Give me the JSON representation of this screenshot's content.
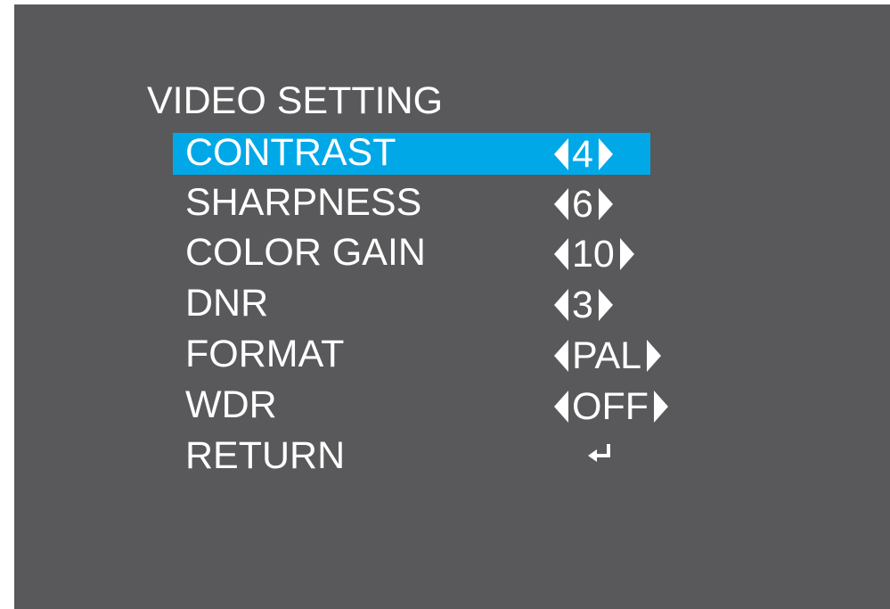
{
  "menu": {
    "title": "VIDEO SETTING",
    "selected_index": 0,
    "colors": {
      "background": "#59595b",
      "highlight": "#00a8e8",
      "text": "#ffffff"
    },
    "items": [
      {
        "label": "CONTRAST",
        "value": "4"
      },
      {
        "label": "SHARPNESS",
        "value": "6"
      },
      {
        "label": "COLOR GAIN",
        "value": "10"
      },
      {
        "label": "DNR",
        "value": "3"
      },
      {
        "label": "FORMAT",
        "value": "PAL"
      },
      {
        "label": "WDR",
        "value": "OFF"
      },
      {
        "label": "RETURN",
        "value": "",
        "icon": "return-enter-icon"
      }
    ]
  }
}
